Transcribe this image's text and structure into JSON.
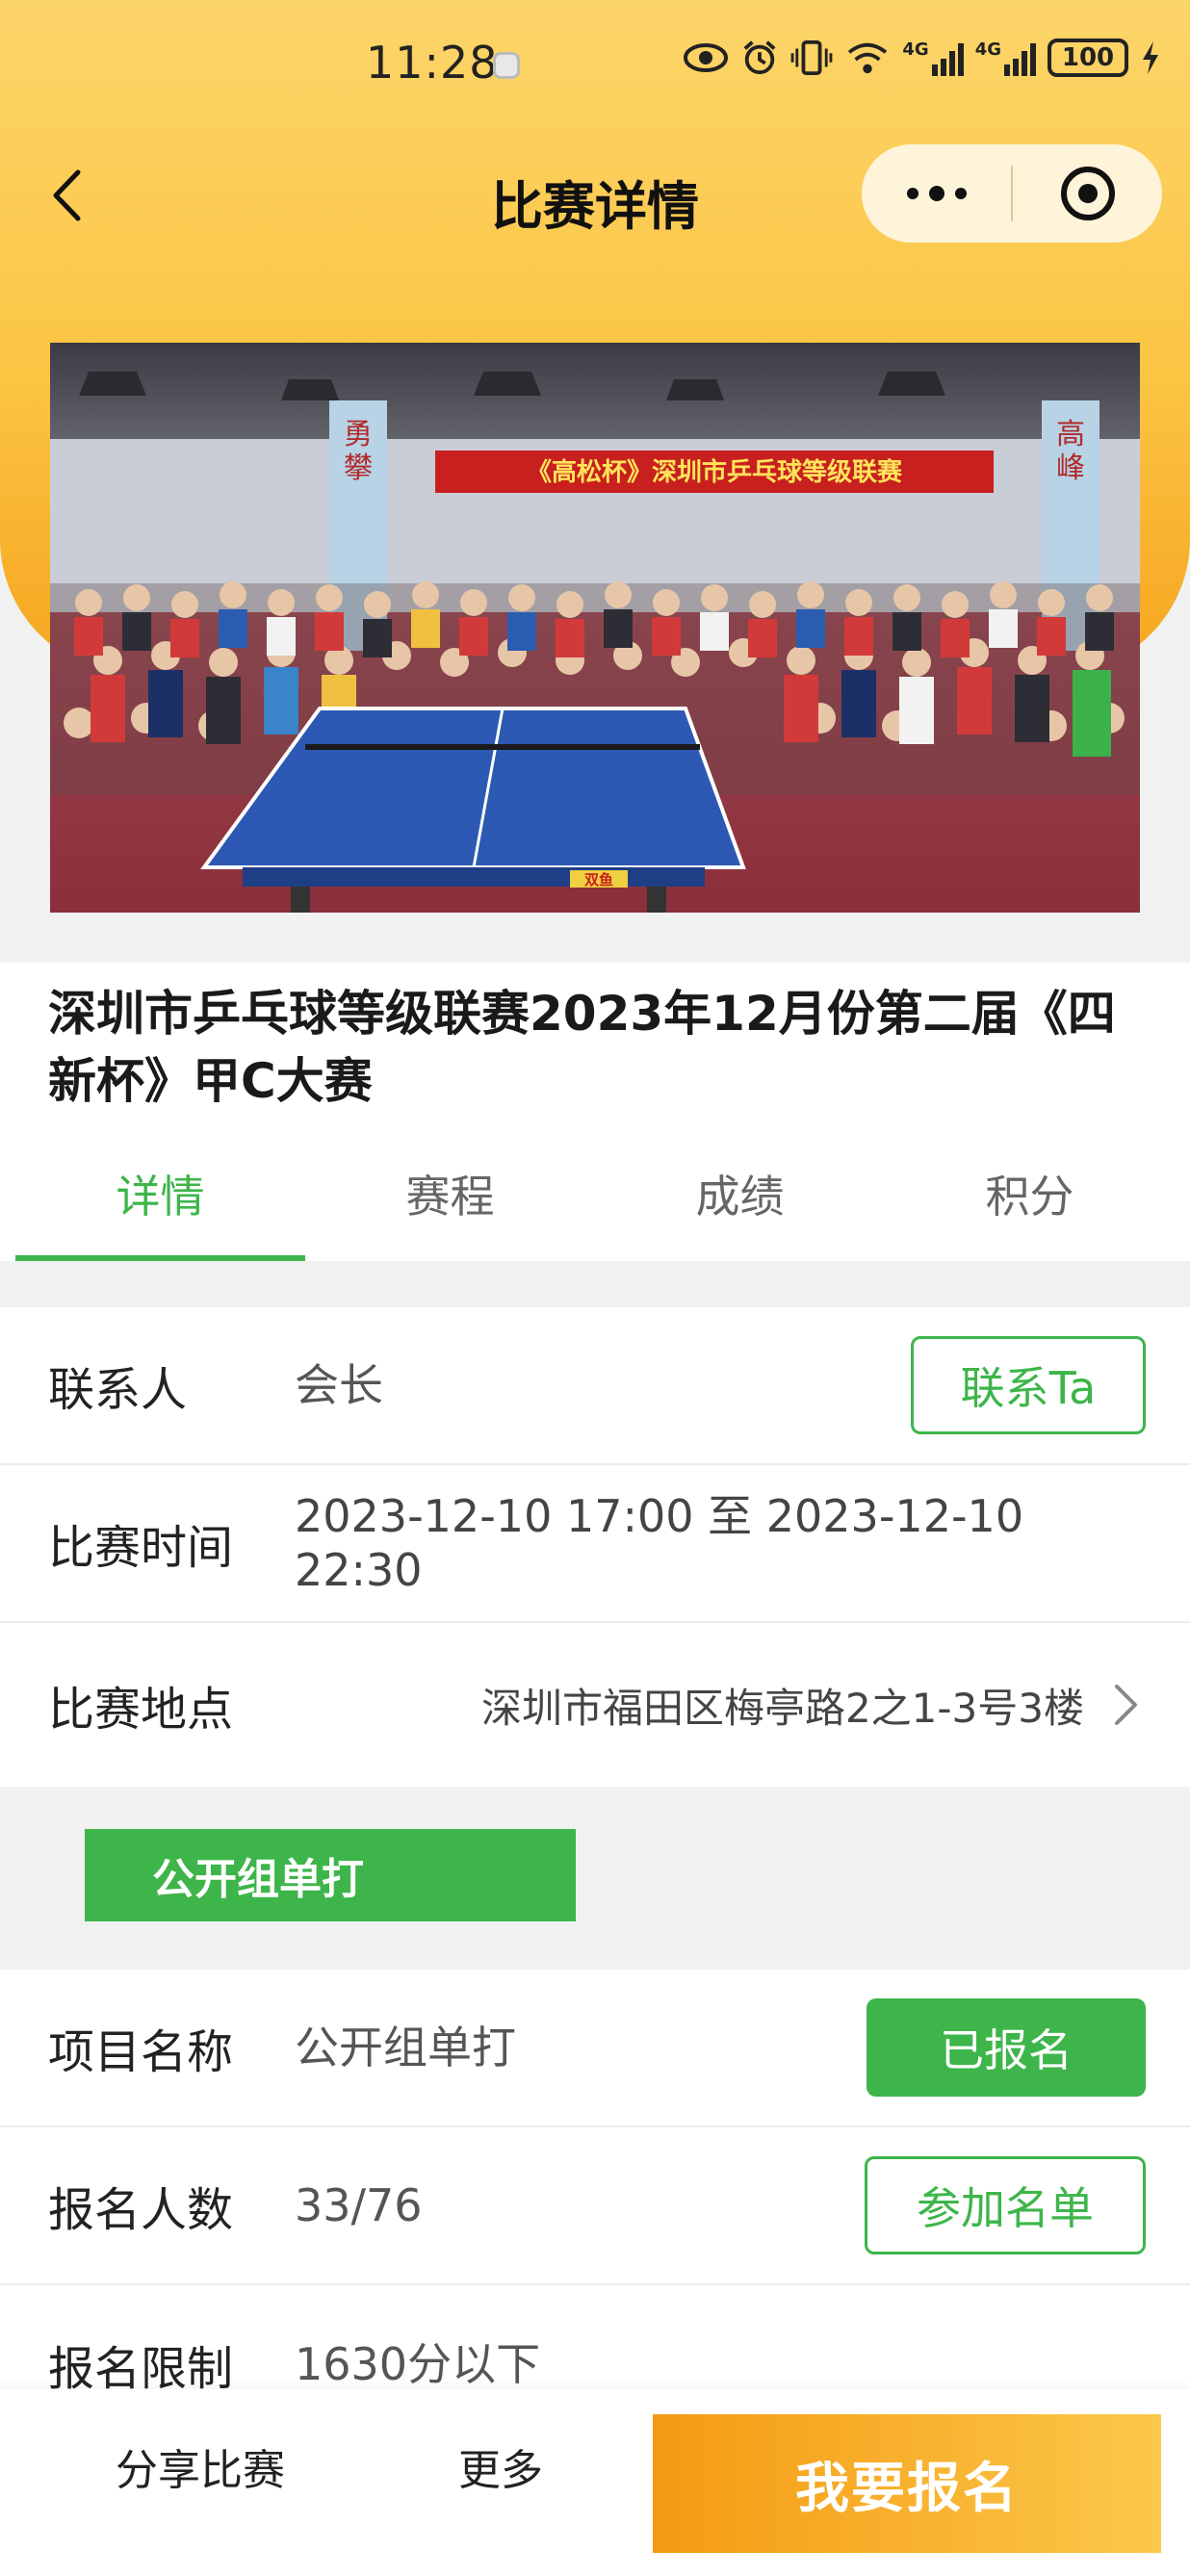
{
  "status_bar": {
    "time": "11:28",
    "network_1": "4G",
    "network_2": "4G",
    "battery": "100"
  },
  "nav": {
    "title": "比赛详情"
  },
  "hero": {
    "banner_text": "《高松杯》深圳市乒乓球等级联赛",
    "pillar_left": "勇攀",
    "pillar_right": "高峰",
    "table_brand": "双鱼"
  },
  "event": {
    "title": "深圳市乒乓球等级联赛2023年12月份第二届《四新杯》甲C大赛"
  },
  "tabs": [
    {
      "label": "详情",
      "active": true
    },
    {
      "label": "赛程",
      "active": false
    },
    {
      "label": "成绩",
      "active": false
    },
    {
      "label": "积分",
      "active": false
    }
  ],
  "info": {
    "contact_label": "联系人",
    "contact_value": "会长",
    "contact_button": "联系Ta",
    "time_label": "比赛时间",
    "time_value": "2023-12-10 17:00 至 2023-12-10 22:30",
    "location_label": "比赛地点",
    "location_value": "深圳市福田区梅亭路2之1-3号3楼"
  },
  "group": {
    "banner": "公开组单打",
    "item_label": "项目名称",
    "item_value": "公开组单打",
    "item_button": "已报名",
    "count_label": "报名人数",
    "count_value": "33/76",
    "count_button": "参加名单",
    "limit_label": "报名限制",
    "limit_value": "1630分以下"
  },
  "bottom_bar": {
    "share": "分享比赛",
    "more": "更多",
    "signup": "我要报名"
  },
  "colors": {
    "accent_green": "#3db54a",
    "header_yellow": "#fbc544",
    "signup_orange": "#f59a12"
  }
}
